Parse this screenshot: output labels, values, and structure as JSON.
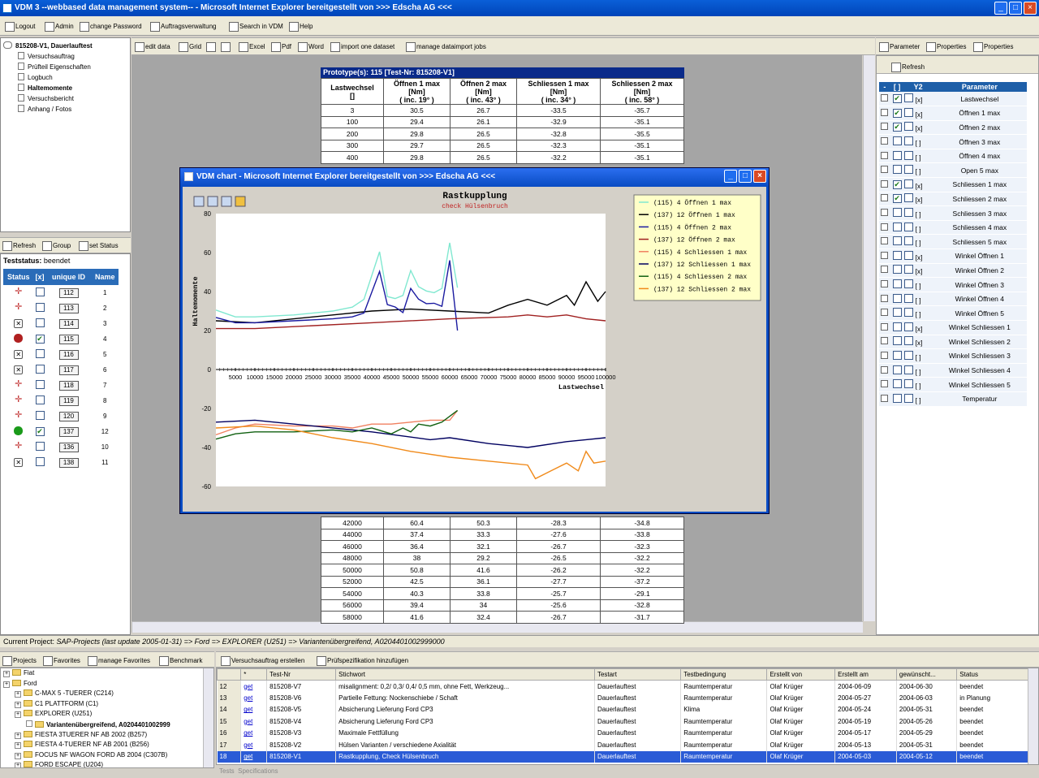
{
  "window": {
    "title": "VDM 3 --webbased data management system-- - Microsoft Internet Explorer bereitgestellt von >>> Edscha AG <<<"
  },
  "toolbar": {
    "items": [
      "Logout",
      "Admin",
      "change Password",
      "Auftragsverwaltung",
      "Search in VDM",
      "Help"
    ]
  },
  "tree": {
    "root": "815208-V1, Dauerlauftest",
    "items": [
      "Versuchsauftrag",
      "Prüfteil Eigenschaften",
      "Logbuch",
      "Haltemomente",
      "Versuchsbericht",
      "Anhang / Fotos"
    ]
  },
  "center_toolbar": [
    "edit data",
    "Grid",
    "Excel",
    "Pdf",
    "Word",
    "import one dataset",
    "manage dataimport jobs"
  ],
  "status_panel": {
    "buttons": [
      "Refresh",
      "Group",
      "set Status"
    ],
    "teststatus_label": "Teststatus:",
    "teststatus_value": "beendet",
    "headers": [
      "Status",
      "[x]",
      "unique ID",
      "Name"
    ],
    "rows": [
      {
        "id": "112",
        "name": "1",
        "checked": false,
        "icon": "target-icon"
      },
      {
        "id": "113",
        "name": "2",
        "checked": false,
        "icon": "target-icon"
      },
      {
        "id": "114",
        "name": "3",
        "checked": false,
        "icon": "x-box-icon"
      },
      {
        "id": "115",
        "name": "4",
        "checked": true,
        "icon": "thumb-down-icon"
      },
      {
        "id": "116",
        "name": "5",
        "checked": false,
        "icon": "x-box-icon"
      },
      {
        "id": "117",
        "name": "6",
        "checked": false,
        "icon": "x-box-icon"
      },
      {
        "id": "118",
        "name": "7",
        "checked": false,
        "icon": "target-icon"
      },
      {
        "id": "119",
        "name": "8",
        "checked": false,
        "icon": "target-icon"
      },
      {
        "id": "120",
        "name": "9",
        "checked": false,
        "icon": "target-icon"
      },
      {
        "id": "137",
        "name": "12",
        "checked": true,
        "icon": "thumb-up-icon"
      },
      {
        "id": "136",
        "name": "10",
        "checked": false,
        "icon": "target-icon"
      },
      {
        "id": "138",
        "name": "11",
        "checked": false,
        "icon": "x-box-icon"
      }
    ]
  },
  "datatable": {
    "caption": "Prototype(s): 115    [Test-Nr: 815208-V1]",
    "headers": [
      [
        "Lastwechsel",
        "[]",
        ""
      ],
      [
        "Öffnen 1 max",
        "[Nm]",
        "( inc. 19° )"
      ],
      [
        "Öffnen 2 max",
        "[Nm]",
        "( inc. 43° )"
      ],
      [
        "Schliessen 1 max",
        "[Nm]",
        "( inc. 34° )"
      ],
      [
        "Schliessen 2 max",
        "[Nm]",
        "( inc. 58° )"
      ]
    ],
    "rows_top": [
      [
        "3",
        "30.5",
        "26.7",
        "-33.5",
        "-35.7"
      ],
      [
        "100",
        "29.4",
        "26.1",
        "-32.9",
        "-35.1"
      ],
      [
        "200",
        "29.8",
        "26.5",
        "-32.8",
        "-35.5"
      ],
      [
        "300",
        "29.7",
        "26.5",
        "-32.3",
        "-35.1"
      ],
      [
        "400",
        "29.8",
        "26.5",
        "-32.2",
        "-35.1"
      ]
    ],
    "rows_bottom": [
      [
        "42000",
        "60.4",
        "50.3",
        "-28.3",
        "-34.8"
      ],
      [
        "44000",
        "37.4",
        "33.3",
        "-27.6",
        "-33.8"
      ],
      [
        "46000",
        "36.4",
        "32.1",
        "-26.7",
        "-32.3"
      ],
      [
        "48000",
        "38",
        "29.2",
        "-26.5",
        "-32.2"
      ],
      [
        "50000",
        "50.8",
        "41.6",
        "-26.2",
        "-32.2"
      ],
      [
        "52000",
        "42.5",
        "36.1",
        "-27.7",
        "-37.2"
      ],
      [
        "54000",
        "40.3",
        "33.8",
        "-25.7",
        "-29.1"
      ],
      [
        "56000",
        "39.4",
        "34",
        "-25.6",
        "-32.8"
      ],
      [
        "58000",
        "41.6",
        "32.4",
        "-26.7",
        "-31.7"
      ]
    ]
  },
  "dialog": {
    "title": "VDM chart - Microsoft Internet Explorer bereitgestellt von >>> Edscha AG <<<"
  },
  "chart_data": {
    "type": "line",
    "title": "Rastkupplung",
    "subtitle": "check Hülsenbruch",
    "ylabel": "Haltemomente",
    "xlabel": "Lastwechsel",
    "ylim": [
      -60,
      80
    ],
    "xlim": [
      0,
      100000
    ],
    "yticks": [
      80,
      60,
      40,
      20,
      0,
      -20,
      -40,
      -60
    ],
    "xticks": [
      5000,
      10000,
      15000,
      20000,
      25000,
      30000,
      35000,
      40000,
      45000,
      50000,
      55000,
      60000,
      65000,
      70000,
      75000,
      80000,
      85000,
      90000,
      95000,
      100000
    ],
    "legend_position": "top-right",
    "series": [
      {
        "name": "(115) 4 Öffnen 1 max",
        "color": "#80e8d0",
        "x": [
          3,
          5000,
          10000,
          20000,
          30000,
          35000,
          38000,
          42000,
          44000,
          46000,
          48000,
          50000,
          52000,
          54000,
          56000,
          58000,
          60000,
          62000
        ],
        "y": [
          30.5,
          27,
          27,
          28,
          30,
          32,
          36,
          60.4,
          37.4,
          36.4,
          38,
          50.8,
          42.5,
          40.3,
          39.4,
          41.6,
          65,
          42
        ]
      },
      {
        "name": "(137) 12 Öffnen 1 max",
        "color": "#000000",
        "x": [
          3,
          10000,
          20000,
          30000,
          40000,
          50000,
          60000,
          70000,
          75000,
          80000,
          85000,
          90000,
          92000,
          95000,
          98000,
          100000
        ],
        "y": [
          25,
          24,
          26,
          28,
          30,
          31,
          30,
          29,
          33,
          36,
          33,
          38,
          33,
          45,
          35,
          40
        ]
      },
      {
        "name": "(115) 4 Öffnen 2 max",
        "color": "#1a1aa0",
        "x": [
          3,
          5000,
          10000,
          20000,
          30000,
          35000,
          38000,
          42000,
          44000,
          46000,
          48000,
          50000,
          52000,
          54000,
          56000,
          58000,
          60000,
          62000
        ],
        "y": [
          26.7,
          24,
          24,
          25,
          26,
          27,
          29,
          50.3,
          33.3,
          32.1,
          29.2,
          41.6,
          36.1,
          33.8,
          34,
          32.4,
          56,
          20
        ]
      },
      {
        "name": "(137) 12 Öffnen 2 max",
        "color": "#a02020",
        "x": [
          3,
          10000,
          20000,
          40000,
          60000,
          75000,
          80000,
          85000,
          90000,
          95000,
          100000
        ],
        "y": [
          21,
          21,
          22,
          24,
          26,
          27,
          28,
          27,
          28,
          26,
          25
        ]
      },
      {
        "name": "(115) 4 Schliessen 1 max",
        "color": "#f08060",
        "x": [
          3,
          5000,
          10000,
          20000,
          30000,
          35000,
          40000,
          45000,
          50000,
          55000,
          60000,
          62000
        ],
        "y": [
          -33.5,
          -30,
          -28,
          -29,
          -29,
          -30,
          -28,
          -28,
          -27,
          -26,
          -26,
          -21
        ]
      },
      {
        "name": "(137) 12 Schliessen 1 max",
        "color": "#000060",
        "x": [
          3,
          10000,
          20000,
          40000,
          55000,
          60000,
          70000,
          80000,
          90000,
          95000,
          100000
        ],
        "y": [
          -27,
          -26,
          -28,
          -32,
          -36,
          -35,
          -38,
          -40,
          -37,
          -36,
          -35
        ]
      },
      {
        "name": "(115) 4 Schliessen 2 max",
        "color": "#106010",
        "x": [
          3,
          5000,
          10000,
          20000,
          30000,
          35000,
          40000,
          45000,
          48000,
          50000,
          52000,
          55000,
          58000,
          62000
        ],
        "y": [
          -35.7,
          -33,
          -32,
          -32,
          -31,
          -32,
          -30,
          -33,
          -30,
          -32,
          -28,
          -29,
          -27,
          -21
        ]
      },
      {
        "name": "(137) 12 Schliessen 2 max",
        "color": "#f08a1a",
        "x": [
          3,
          10000,
          20000,
          30000,
          40000,
          50000,
          60000,
          70000,
          80000,
          82000,
          86000,
          90000,
          93000,
          95000,
          97000,
          100000
        ],
        "y": [
          -30,
          -29,
          -31,
          -35,
          -38,
          -42,
          -45,
          -47,
          -49,
          -56,
          -52,
          -48,
          -52,
          -42,
          -48,
          -47
        ]
      }
    ]
  },
  "right_panel": {
    "tabs": [
      "Parameter",
      "Properties",
      "Properties"
    ],
    "refresh": "Refresh",
    "headers": [
      "-",
      "[ ]",
      "Y2",
      "Parameter"
    ],
    "rows": [
      {
        "c": true,
        "y2": "[x]",
        "name": "Lastwechsel"
      },
      {
        "c": true,
        "y2": "[x]",
        "name": "Öffnen 1 max"
      },
      {
        "c": true,
        "y2": "[x]",
        "name": "Öffnen 2 max"
      },
      {
        "c": false,
        "y2": "[ ]",
        "name": "Öffnen 3 max"
      },
      {
        "c": false,
        "y2": "[ ]",
        "name": "Öffnen 4 max"
      },
      {
        "c": false,
        "y2": "[ ]",
        "name": "Open 5 max"
      },
      {
        "c": true,
        "y2": "[x]",
        "name": "Schliessen 1 max"
      },
      {
        "c": true,
        "y2": "[x]",
        "name": "Schliessen 2 max"
      },
      {
        "c": false,
        "y2": "[ ]",
        "name": "Schliessen 3 max"
      },
      {
        "c": false,
        "y2": "[ ]",
        "name": "Schliessen 4 max"
      },
      {
        "c": false,
        "y2": "[ ]",
        "name": "Schliessen 5 max"
      },
      {
        "c": false,
        "y2": "[x]",
        "name": "Winkel Öffnen 1"
      },
      {
        "c": false,
        "y2": "[x]",
        "name": "Winkel Öffnen 2"
      },
      {
        "c": false,
        "y2": "[ ]",
        "name": "Winkel Öffnen 3"
      },
      {
        "c": false,
        "y2": "[ ]",
        "name": "Winkel Öffnen 4"
      },
      {
        "c": false,
        "y2": "[ ]",
        "name": "Winkel Öffnen 5"
      },
      {
        "c": false,
        "y2": "[x]",
        "name": "Winkel Schliessen 1"
      },
      {
        "c": false,
        "y2": "[x]",
        "name": "Winkel Schliessen 2"
      },
      {
        "c": false,
        "y2": "[ ]",
        "name": "Winkel Schliessen 3"
      },
      {
        "c": false,
        "y2": "[ ]",
        "name": "Winkel Schliessen 4"
      },
      {
        "c": false,
        "y2": "[ ]",
        "name": "Winkel Schliessen 5"
      },
      {
        "c": false,
        "y2": "[ ]",
        "name": "Temperatur"
      }
    ]
  },
  "project_bar": {
    "label": "Current Project:",
    "value": "SAP-Projects (last update 2005-01-31) => Ford => EXPLORER (U251) => Variantenübergreifend, A0204401002999000"
  },
  "bottom_left": {
    "tabs": [
      "Projects",
      "Favorites",
      "manage Favorites",
      "Benchmark"
    ],
    "tree": [
      {
        "t": "Fiat",
        "l": 0
      },
      {
        "t": "Ford",
        "l": 0
      },
      {
        "t": "C-MAX 5 -TUERER (C214)",
        "l": 1
      },
      {
        "t": "C1 PLATTFORM (C1)",
        "l": 1
      },
      {
        "t": "EXPLORER (U251)",
        "l": 1
      },
      {
        "t": "Variantenübergreifend, A0204401002999",
        "l": 2
      },
      {
        "t": "FIESTA 3TUERER NF AB 2002 (B257)",
        "l": 1
      },
      {
        "t": "FIESTA 4-TUERER NF AB 2001 (B256)",
        "l": 1
      },
      {
        "t": "FOCUS NF WAGON FORD AB 2004 (C307B)",
        "l": 1
      },
      {
        "t": "FORD ESCAPE (U204)",
        "l": 1
      }
    ]
  },
  "bottom_right": {
    "buttons": [
      "Versuchsauftrag erstellen",
      "Prüfspezifikation hinzufügen"
    ],
    "headers": [
      "",
      "*",
      "Test-Nr",
      "Stichwort",
      "Testart",
      "Testbedingung",
      "Erstellt von",
      "Erstellt am",
      "gewünscht...",
      "Status"
    ],
    "rows": [
      [
        "12",
        "get",
        "815208-V7",
        "misalignment: 0,2/ 0,3/ 0,4/ 0,5 mm, ohne Fett, Werkzeug...",
        "Dauerlauftest",
        "Raumtemperatur",
        "Olaf Krüger",
        "2004-06-09",
        "2004-06-30",
        "beendet"
      ],
      [
        "13",
        "get",
        "815208-V6",
        "Partielle Fettung: Nockenschiebe / Schaft",
        "Dauerlauftest",
        "Raumtemperatur",
        "Olaf Krüger",
        "2004-05-27",
        "2004-06-03",
        "in Planung"
      ],
      [
        "14",
        "get",
        "815208-V5",
        "Absicherung Lieferung Ford CP3",
        "Dauerlauftest",
        "Klima",
        "Olaf Krüger",
        "2004-05-24",
        "2004-05-31",
        "beendet"
      ],
      [
        "15",
        "get",
        "815208-V4",
        "Absicherung Lieferung Ford CP3",
        "Dauerlauftest",
        "Raumtemperatur",
        "Olaf Krüger",
        "2004-05-19",
        "2004-05-26",
        "beendet"
      ],
      [
        "16",
        "get",
        "815208-V3",
        "Maximale Fettfüllung",
        "Dauerlauftest",
        "Raumtemperatur",
        "Olaf Krüger",
        "2004-05-17",
        "2004-05-29",
        "beendet"
      ],
      [
        "17",
        "get",
        "815208-V2",
        "Hülsen Varianten / verschiedene Axialität",
        "Dauerlauftest",
        "Raumtemperatur",
        "Olaf Krüger",
        "2004-05-13",
        "2004-05-31",
        "beendet"
      ],
      [
        "18",
        "get",
        "815208-V1",
        "Rastkupplung, Check Hülsenbruch",
        "Dauerlauftest",
        "Raumtemperatur",
        "Olaf Krüger",
        "2004-05-03",
        "2004-05-12",
        "beendet"
      ]
    ],
    "footer_tabs": [
      "Tests",
      "Specifications"
    ]
  }
}
